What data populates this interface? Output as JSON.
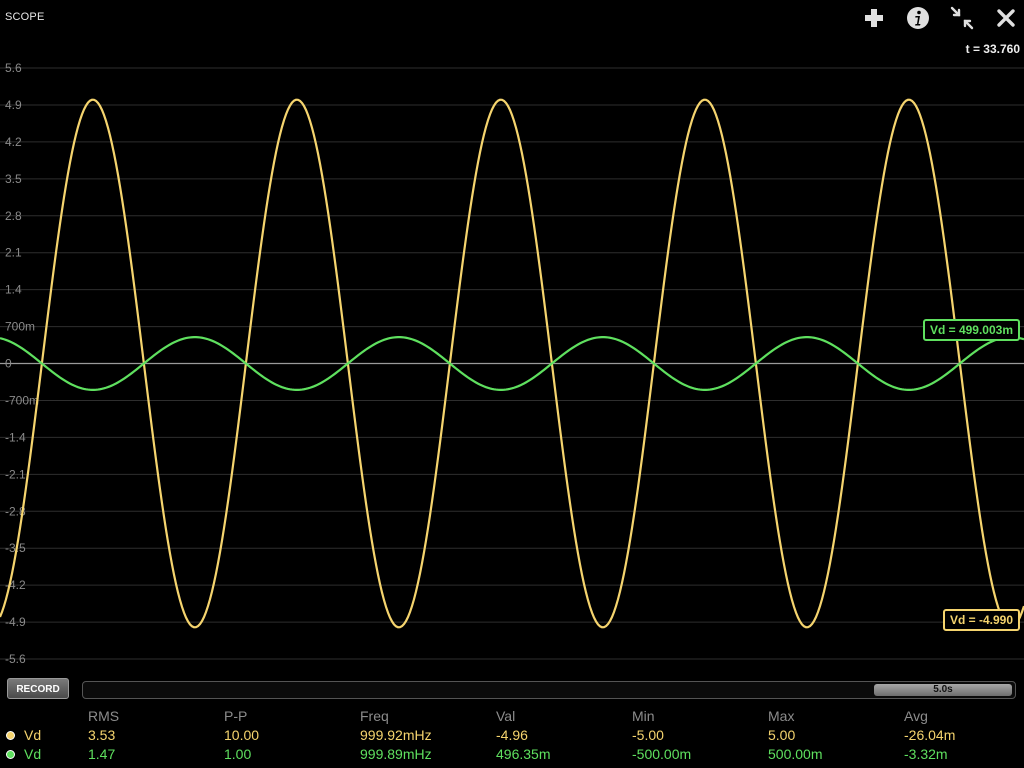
{
  "app": {
    "title": "SCOPE",
    "time_readout": "t = 33.760",
    "toolbar": [
      "plus-icon",
      "info-icon",
      "compress-icon",
      "close-icon"
    ]
  },
  "plot": {
    "y_ticks": [
      "5.6",
      "4.9",
      "4.2",
      "3.5",
      "2.8",
      "2.1",
      "1.4",
      "700m",
      "0",
      "-700m",
      "-1.4",
      "-2.1",
      "-2.8",
      "-3.5",
      "-4.2",
      "-4.9",
      "-5.6"
    ],
    "y_range": [
      -5.6,
      5.6
    ],
    "grid": true,
    "colors": {
      "trace1": "#f5d46e",
      "trace2": "#5fe05f",
      "grid": "#2e2e2e",
      "zero_line": "#9a9a9a"
    },
    "cursor1_label": "Vd = 499.003m",
    "cursor2_label": "Vd = -4.990"
  },
  "chart_data": {
    "type": "line",
    "title": "",
    "xlabel": "",
    "ylabel": "",
    "ylim": [
      -5.6,
      5.6
    ],
    "x_window_s": 5.0,
    "series": [
      {
        "name": "Vd",
        "color": "#f5d46e",
        "amplitude": 5.0,
        "frequency_hz": 0.99992,
        "cycles_visible": 5,
        "last_value": -4.99
      },
      {
        "name": "Vd",
        "color": "#5fe05f",
        "amplitude": 0.5,
        "frequency_hz": 0.99989,
        "cycles_visible": 5,
        "last_value": 0.499003
      }
    ]
  },
  "controls": {
    "record_label": "RECORD",
    "timeline_label": "5.0s",
    "timeline_position": 0.85
  },
  "stats": {
    "headers": [
      "RMS",
      "P-P",
      "Freq",
      "Val",
      "Min",
      "Max",
      "Avg"
    ],
    "rows": [
      {
        "name": "Vd",
        "color": "#f5d46e",
        "values": [
          "3.53",
          "10.00",
          "999.92mHz",
          "-4.96",
          "-5.00",
          "5.00",
          "-26.04m"
        ]
      },
      {
        "name": "Vd",
        "color": "#5fe05f",
        "values": [
          "1.47",
          "1.00",
          "999.89mHz",
          "496.35m",
          "-500.00m",
          "500.00m",
          "-3.32m"
        ]
      }
    ]
  }
}
